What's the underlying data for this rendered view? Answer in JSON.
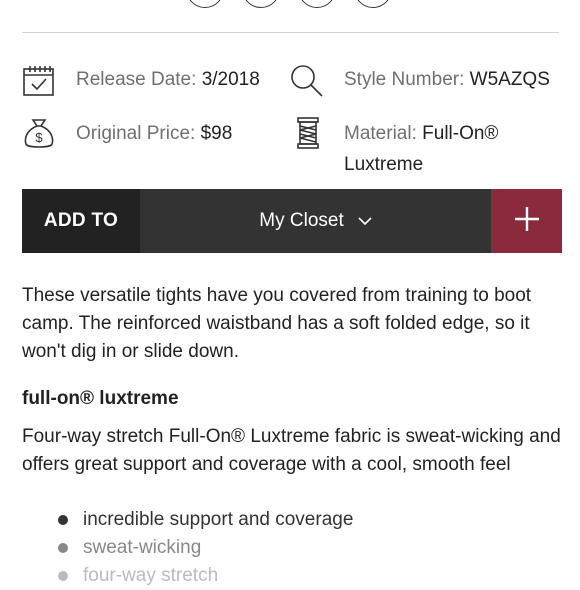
{
  "product_meta": {
    "release_date_label": "Release Date:",
    "release_date_value": "3/2018",
    "style_number_label": "Style Number:",
    "style_number_value": "W5AZQS",
    "original_price_label": "Original Price:",
    "original_price_value": "$98",
    "material_label": "Material:",
    "material_value_line1": "Full-On®",
    "material_value_line2": "Luxtreme"
  },
  "add_bar": {
    "add_to_label": "ADD TO",
    "closet_label": "My Closet",
    "plus_label": "+"
  },
  "description": {
    "text": "These versatile tights have you covered from training to boot camp. The reinforced waistband has a soft folded edge, so it won't dig in or slide down."
  },
  "feature": {
    "title": "full-on® luxtreme",
    "description": "Four-way stretch Full-On® Luxtreme fabric is sweat-wicking and offers great support and coverage with a cool, smooth feel",
    "bullets": [
      {
        "text": "incredible support and coverage",
        "color": "#333333"
      },
      {
        "text": "sweat-wicking",
        "color": "#888888"
      },
      {
        "text": "four-way stretch",
        "color": "#bbbbbb"
      }
    ]
  },
  "icons": {
    "release_date": "calendar-check-icon",
    "style_number": "search-icon",
    "original_price": "money-bag-icon",
    "material": "fabric-spool-icon",
    "closet_dropdown": "chevron-down-icon",
    "add": "plus-icon"
  },
  "colors": {
    "add_to_bg": "#222222",
    "closet_bg": "#333333",
    "plus_bg": "#8a2a3c"
  }
}
